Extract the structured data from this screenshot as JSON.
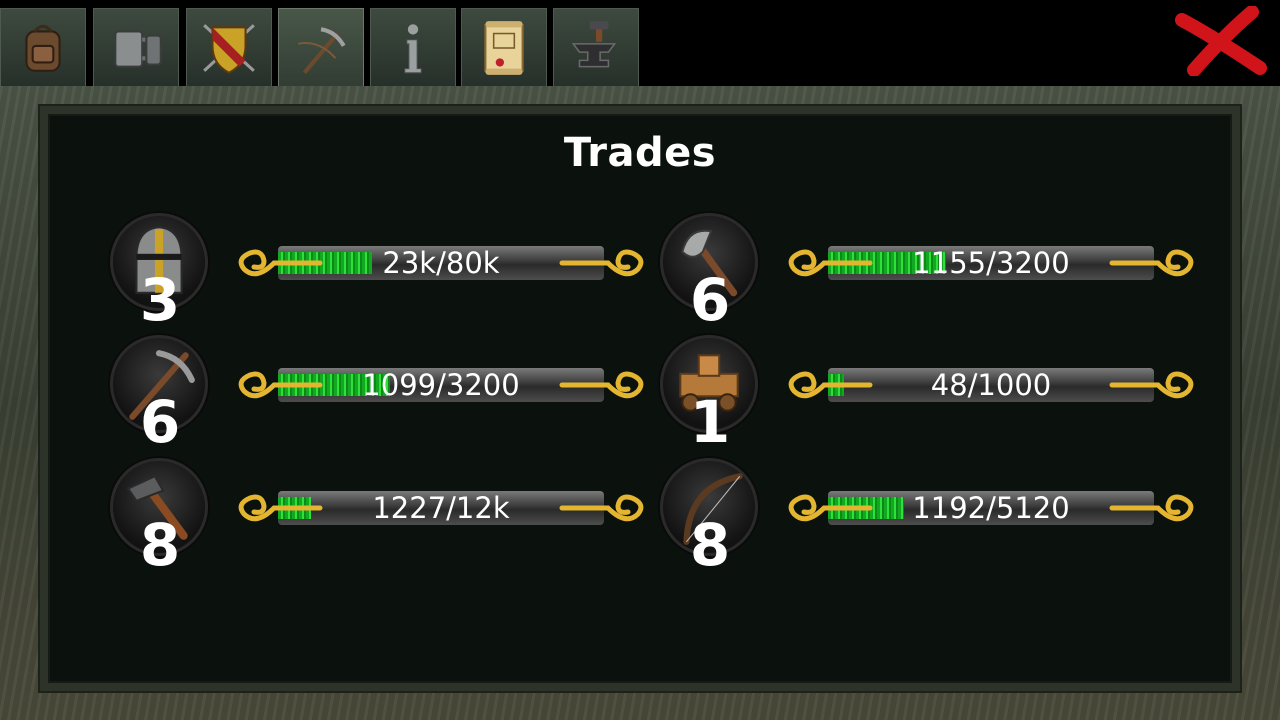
{
  "tabs": [
    {
      "name": "backpack-icon"
    },
    {
      "name": "tankard-icon"
    },
    {
      "name": "shield-icon"
    },
    {
      "name": "pickaxe-icon"
    },
    {
      "name": "info-icon"
    },
    {
      "name": "scroll-icon"
    },
    {
      "name": "anvil-icon"
    }
  ],
  "active_tab": 3,
  "close_icon": "close-x-icon",
  "panel": {
    "title": "Trades"
  },
  "trades": [
    {
      "icon": "helmet-icon",
      "level": "3",
      "progress_text": "23k/80k",
      "progress": 0.2875
    },
    {
      "icon": "axe-icon",
      "level": "6",
      "progress_text": "1155/3200",
      "progress": 0.361
    },
    {
      "icon": "pickaxe-icon",
      "level": "6",
      "progress_text": "1099/3200",
      "progress": 0.343
    },
    {
      "icon": "siege-cart-icon",
      "level": "1",
      "progress_text": "48/1000",
      "progress": 0.048
    },
    {
      "icon": "hammer-icon",
      "level": "8",
      "progress_text": "1227/12k",
      "progress": 0.102
    },
    {
      "icon": "bow-icon",
      "level": "8",
      "progress_text": "1192/5120",
      "progress": 0.233
    }
  ],
  "colors": {
    "bar_fill": "#2ee03a",
    "ornament_gold": "#e3b530",
    "close_red": "#d0141a",
    "panel_bg": "#0b120d"
  }
}
